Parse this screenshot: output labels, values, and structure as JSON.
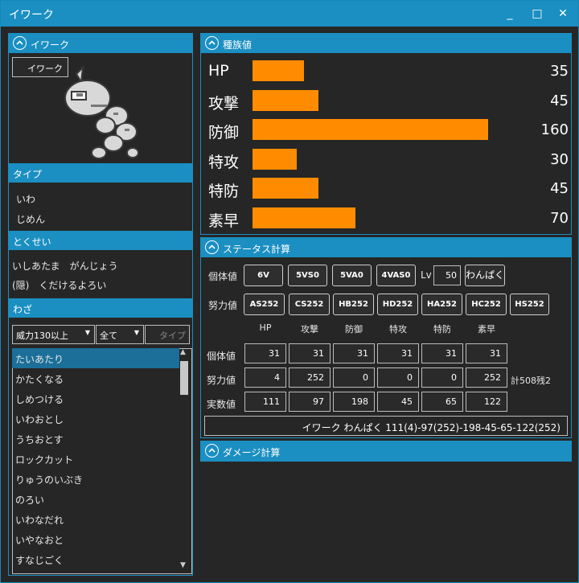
{
  "window": {
    "title": "イワーク",
    "minimize": "_",
    "maximize": "□",
    "close": "✕"
  },
  "left": {
    "pokemon_header": "イワーク",
    "name_box": "イワーク",
    "type_header": "タイプ",
    "types": [
      "いわ",
      "じめん"
    ],
    "ability_header": "とくせい",
    "abilities": [
      "いしあたま　がんじょう",
      "(隠)　くだけるよろい"
    ],
    "moves_header": "わざ",
    "filter_power": "威力130以上",
    "filter_all": "全て",
    "filter_type": "タイプ",
    "moves": [
      "たいあたり",
      "かたくなる",
      "しめつける",
      "いわおとし",
      "うちおとす",
      "ロックカット",
      "りゅうのいぶき",
      "のろい",
      "いわなだれ",
      "いやなおと",
      "すなじごく"
    ]
  },
  "base_stats": {
    "header": "種族値",
    "stats": [
      {
        "label": "HP",
        "value": "35",
        "ratio": 0.219
      },
      {
        "label": "攻撃",
        "value": "45",
        "ratio": 0.281
      },
      {
        "label": "防御",
        "value": "160",
        "ratio": 1.0
      },
      {
        "label": "特攻",
        "value": "30",
        "ratio": 0.188
      },
      {
        "label": "特防",
        "value": "45",
        "ratio": 0.281
      },
      {
        "label": "素早",
        "value": "70",
        "ratio": 0.438
      }
    ]
  },
  "calc": {
    "header": "ステータス計算",
    "iv_label": "個体値",
    "iv_buttons": [
      "6V",
      "5VS0",
      "5VA0",
      "4VAS0"
    ],
    "lv_label": "Lv",
    "lv_value": "50",
    "nature": "わんぱく",
    "ev_label": "努力値",
    "ev_buttons": [
      "AS252",
      "CS252",
      "HB252",
      "HD252",
      "HA252",
      "HC252",
      "HS252"
    ],
    "columns": [
      "HP",
      "攻撃",
      "防御",
      "特攻",
      "特防",
      "素早"
    ],
    "row_iv": "個体値",
    "row_ev": "努力値",
    "row_actual": "実数値",
    "iv_values": [
      "31",
      "31",
      "31",
      "31",
      "31",
      "31"
    ],
    "ev_values": [
      "4",
      "252",
      "0",
      "0",
      "0",
      "252"
    ],
    "actual_values": [
      "111",
      "97",
      "198",
      "45",
      "65",
      "122"
    ],
    "ev_total": "計508残2",
    "summary": "イワーク わんぱく 111(4)-97(252)-198-45-65-122(252)"
  },
  "damage": {
    "header": "ダメージ計算"
  },
  "colors": {
    "accent": "#1b8fc2",
    "bar": "#ff8c00",
    "background": "#262626"
  }
}
